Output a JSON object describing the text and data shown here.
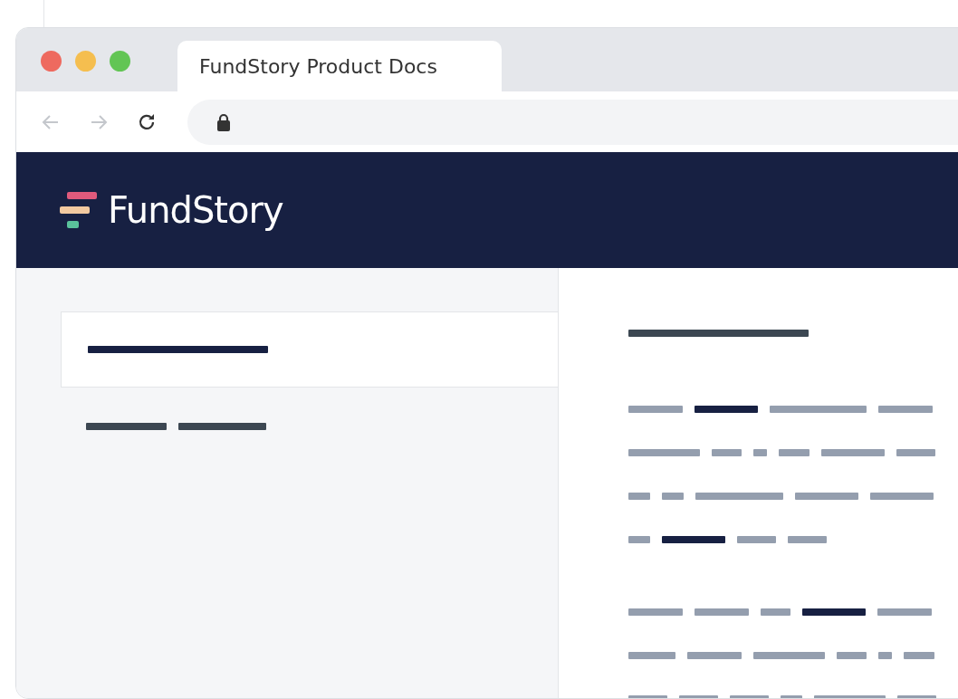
{
  "window": {
    "tab_title": "FundStory Product Docs"
  },
  "header": {
    "brand": "FundStory"
  }
}
